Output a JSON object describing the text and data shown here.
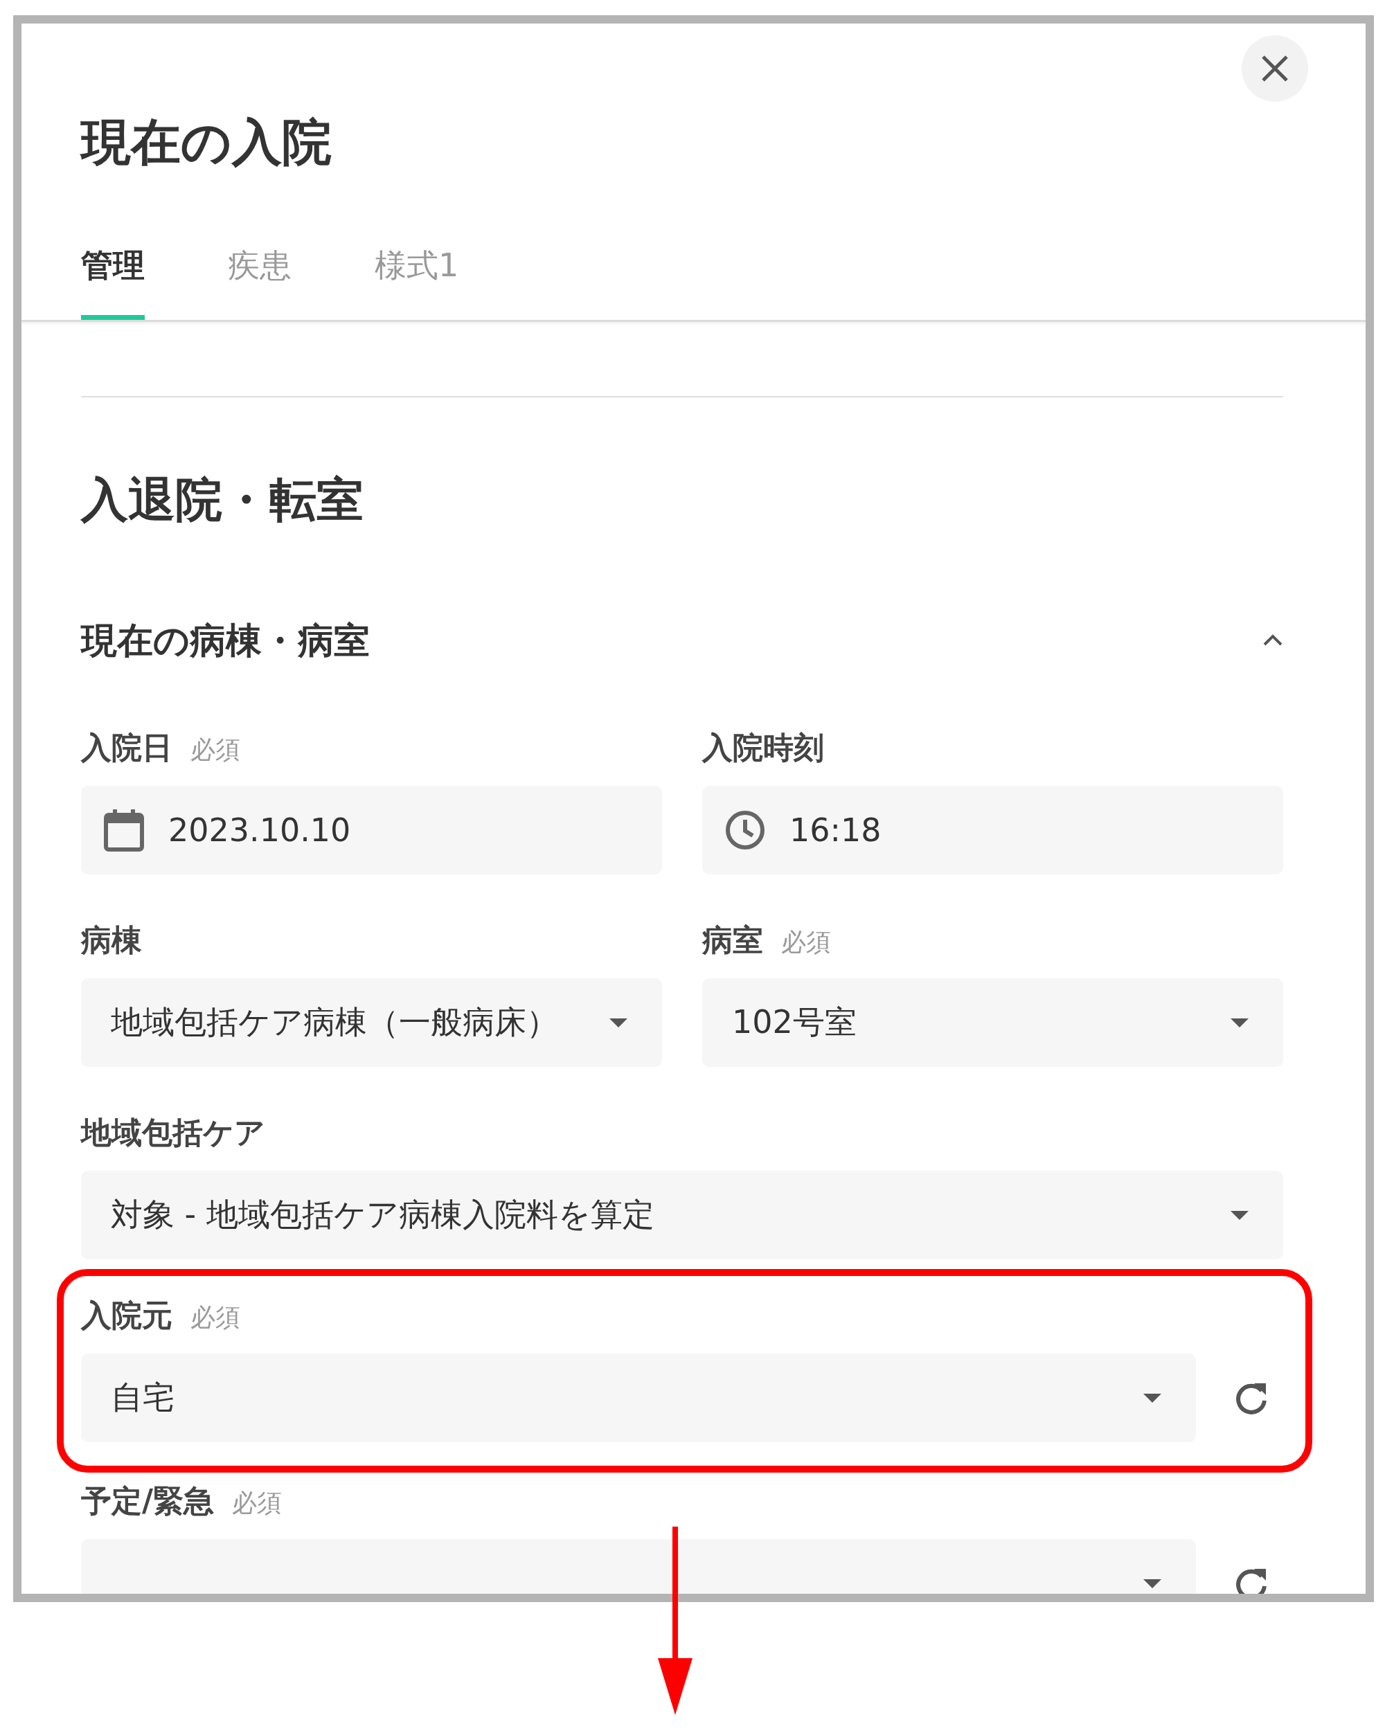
{
  "dialog": {
    "title": "現在の入院"
  },
  "tabs": [
    {
      "label": "管理",
      "selected": true
    },
    {
      "label": "疾患",
      "selected": false
    },
    {
      "label": "様式1",
      "selected": false
    }
  ],
  "section": {
    "title": "入退院・転室"
  },
  "group": {
    "title": "現在の病棟・病室",
    "expanded": true
  },
  "rows": [
    {
      "fields": [
        {
          "kind": "date",
          "label": "入院日",
          "required": "必須",
          "value": "2023.10.10"
        },
        {
          "kind": "time",
          "label": "入院時刻",
          "value": "16:18"
        }
      ]
    },
    {
      "fields": [
        {
          "kind": "select",
          "label": "病棟",
          "value": "地域包括ケア病棟（一般病床）"
        },
        {
          "kind": "select",
          "label": "病室",
          "required": "必須",
          "value": "102号室"
        }
      ]
    },
    {
      "fields": [
        {
          "kind": "select",
          "label": "地域包括ケア",
          "value": "対象 - 地域包括ケア病棟入院料を算定"
        }
      ]
    },
    {
      "highlighted": true,
      "fields": [
        {
          "kind": "select",
          "label": "入院元",
          "required": "必須",
          "value": "自宅",
          "refresh": true
        }
      ]
    },
    {
      "fields": [
        {
          "kind": "select",
          "label": "予定/緊急",
          "required": "必須",
          "refresh": true
        }
      ]
    }
  ]
}
